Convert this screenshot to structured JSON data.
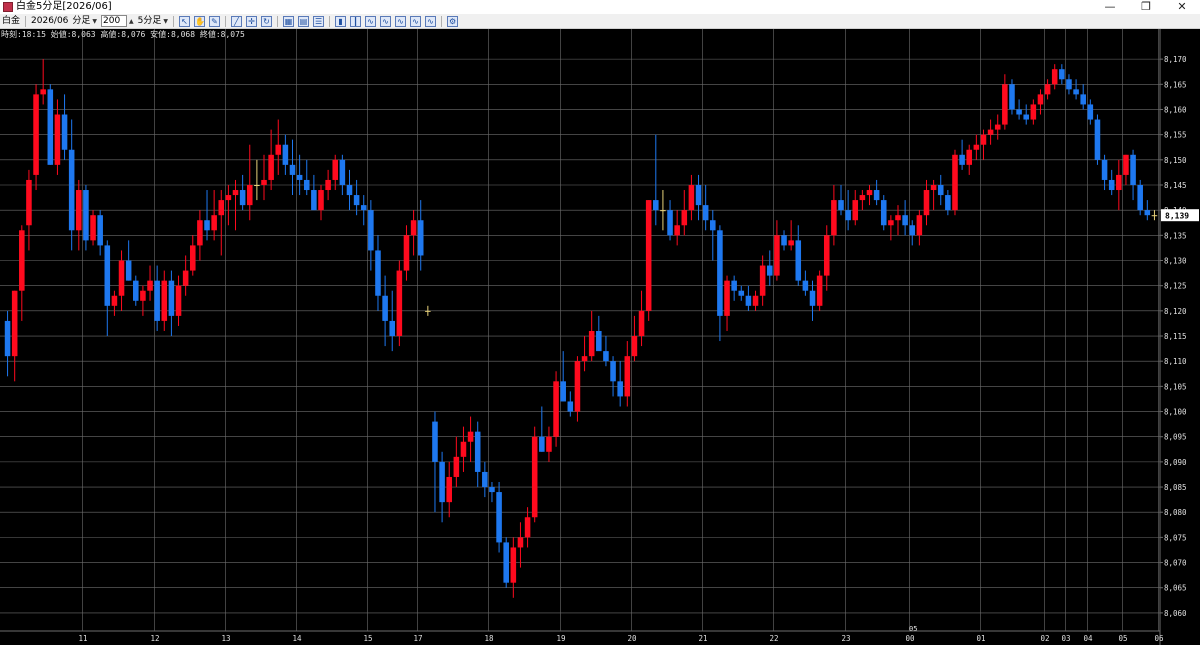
{
  "window": {
    "title": "白金5分足[2026/06]",
    "controls": [
      "—",
      "❐",
      "✕"
    ]
  },
  "toolbar": {
    "instrument": "白金",
    "contract": "2026/06",
    "unit": "分足",
    "bar_count": "200",
    "timeframe": "5分足",
    "icons": [
      "cursor-icon",
      "hand-icon",
      "pencil-icon",
      "trendline-icon",
      "crosshair-icon",
      "refresh-icon",
      "grid-icon",
      "table-icon",
      "list-icon",
      "bar-chart-icon",
      "candle-icon",
      "indicator-icon",
      "indicator2-icon",
      "indicator3-icon",
      "indicator4-icon",
      "indicator5-icon",
      "settings-icon"
    ]
  },
  "info": {
    "text": "時刻:18:15 始値:8,063 高値:8,076 安値:8,068 終値:8,075"
  },
  "colors": {
    "background": "#000000",
    "grid": "#6e6e6e",
    "up": "#ff0a1e",
    "down": "#1e78f0",
    "text": "#e0e0e0",
    "doji": "#e8d27a"
  },
  "chart_data": {
    "type": "candlestick",
    "ylim": [
      8057,
      8174
    ],
    "yticks": [
      {
        "value": 8060,
        "label": "8,060"
      },
      {
        "value": 8065,
        "label": "8,065"
      },
      {
        "value": 8070,
        "label": "8,070"
      },
      {
        "value": 8075,
        "label": "8,075"
      },
      {
        "value": 8080,
        "label": "8,080"
      },
      {
        "value": 8085,
        "label": "8,085"
      },
      {
        "value": 8090,
        "label": "8,090"
      },
      {
        "value": 8095,
        "label": "8,095"
      },
      {
        "value": 8100,
        "label": "8,100"
      },
      {
        "value": 8105,
        "label": "8,105"
      },
      {
        "value": 8110,
        "label": "8,110"
      },
      {
        "value": 8115,
        "label": "8,115"
      },
      {
        "value": 8120,
        "label": "8,120"
      },
      {
        "value": 8125,
        "label": "8,125"
      },
      {
        "value": 8130,
        "label": "8,130"
      },
      {
        "value": 8135,
        "label": "8,135"
      },
      {
        "value": 8140,
        "label": "8,140"
      },
      {
        "value": 8145,
        "label": "8,145"
      },
      {
        "value": 8150,
        "label": "8,150"
      },
      {
        "value": 8155,
        "label": "8,155"
      },
      {
        "value": 8160,
        "label": "8,160"
      },
      {
        "value": 8165,
        "label": "8,165"
      },
      {
        "value": 8170,
        "label": "8,170"
      }
    ],
    "last_price": {
      "value": 8139,
      "label": "8,139"
    },
    "x_labels": [
      {
        "label": "11",
        "index": 11
      },
      {
        "label": "12",
        "index": 21
      },
      {
        "label": "13",
        "index": 31
      },
      {
        "label": "14",
        "index": 41
      },
      {
        "label": "15",
        "index": 51
      },
      {
        "label": "17",
        "index": 58
      },
      {
        "label": "18",
        "index": 68
      },
      {
        "label": "19",
        "index": 78
      },
      {
        "label": "20",
        "index": 88
      },
      {
        "label": "21",
        "index": 98
      },
      {
        "label": "22",
        "index": 108
      },
      {
        "label": "23",
        "index": 118
      },
      {
        "label": "00",
        "index": 127
      },
      {
        "label": "01",
        "index": 137
      },
      {
        "label": "02",
        "index": 146
      },
      {
        "label": "03",
        "index": 149
      },
      {
        "label": "04",
        "index": 152
      },
      {
        "label": "05",
        "index": 157
      },
      {
        "label": "06",
        "index": 162
      }
    ],
    "upper_date_label": {
      "label": "05",
      "index": 127
    },
    "candles": [
      [
        8118,
        8120,
        8107,
        8111
      ],
      [
        8111,
        8124,
        8106,
        8124
      ],
      [
        8124,
        8137,
        8118,
        8136
      ],
      [
        8137,
        8148,
        8132,
        8146
      ],
      [
        8147,
        8165,
        8144,
        8163
      ],
      [
        8163,
        8170,
        8161,
        8164
      ],
      [
        8164,
        8165,
        8149,
        8149
      ],
      [
        8149,
        8162,
        8147,
        8159
      ],
      [
        8159,
        8163,
        8150,
        8152
      ],
      [
        8152,
        8158,
        8132,
        8136
      ],
      [
        8136,
        8146,
        8132,
        8144
      ],
      [
        8144,
        8145,
        8132,
        8134
      ],
      [
        8134,
        8140,
        8133,
        8139
      ],
      [
        8139,
        8140,
        8131,
        8133
      ],
      [
        8133,
        8134,
        8115,
        8121
      ],
      [
        8121,
        8124,
        8119,
        8123
      ],
      [
        8123,
        8132,
        8120,
        8130
      ],
      [
        8130,
        8134,
        8126,
        8126
      ],
      [
        8126,
        8127,
        8121,
        8122
      ],
      [
        8122,
        8125,
        8119,
        8124
      ],
      [
        8124,
        8129,
        8122,
        8126
      ],
      [
        8126,
        8129,
        8116,
        8118
      ],
      [
        8118,
        8128,
        8116,
        8126
      ],
      [
        8126,
        8128,
        8115,
        8119
      ],
      [
        8119,
        8127,
        8117,
        8125
      ],
      [
        8125,
        8131,
        8123,
        8128
      ],
      [
        8128,
        8135,
        8127,
        8133
      ],
      [
        8133,
        8140,
        8130,
        8138
      ],
      [
        8138,
        8144,
        8134,
        8136
      ],
      [
        8136,
        8144,
        8134,
        8139
      ],
      [
        8139,
        8144,
        8131,
        8142
      ],
      [
        8142,
        8145,
        8137,
        8143
      ],
      [
        8143,
        8146,
        8136,
        8144
      ],
      [
        8144,
        8147,
        8140,
        8141
      ],
      [
        8141,
        8153,
        8138,
        8145
      ],
      [
        8145,
        8150,
        8142,
        8145
      ],
      [
        8145,
        8151,
        8142,
        8146
      ],
      [
        8146,
        8156,
        8144,
        8151
      ],
      [
        8151,
        8158,
        8147,
        8153
      ],
      [
        8153,
        8155,
        8147,
        8149
      ],
      [
        8149,
        8154,
        8143,
        8147
      ],
      [
        8147,
        8151,
        8143,
        8146
      ],
      [
        8146,
        8150,
        8143,
        8144
      ],
      [
        8144,
        8147,
        8140,
        8140
      ],
      [
        8140,
        8145,
        8138,
        8144
      ],
      [
        8144,
        8148,
        8142,
        8146
      ],
      [
        8146,
        8151,
        8144,
        8150
      ],
      [
        8150,
        8151,
        8143,
        8145
      ],
      [
        8145,
        8148,
        8140,
        8143
      ],
      [
        8143,
        8146,
        8139,
        8141
      ],
      [
        8141,
        8143,
        8137,
        8140
      ],
      [
        8140,
        8142,
        8128,
        8132
      ],
      [
        8132,
        8135,
        8120,
        8123
      ],
      [
        8123,
        8127,
        8113,
        8118
      ],
      [
        8118,
        8124,
        8112,
        8115
      ],
      [
        8115,
        8130,
        8113,
        8128
      ],
      [
        8128,
        8137,
        8126,
        8135
      ],
      [
        8135,
        8140,
        8131,
        8138
      ],
      [
        8138,
        8142,
        8128,
        8131
      ],
      [
        8120,
        8121,
        8119,
        8120
      ],
      [
        8098,
        8100,
        8080,
        8090
      ],
      [
        8090,
        8092,
        8078,
        8082
      ],
      [
        8082,
        8090,
        8079,
        8087
      ],
      [
        8087,
        8095,
        8085,
        8091
      ],
      [
        8091,
        8097,
        8088,
        8094
      ],
      [
        8094,
        8099,
        8090,
        8096
      ],
      [
        8096,
        8098,
        8085,
        8088
      ],
      [
        8088,
        8090,
        8083,
        8085
      ],
      [
        8085,
        8086,
        8082,
        8084
      ],
      [
        8084,
        8086,
        8072,
        8074
      ],
      [
        8074,
        8075,
        8065,
        8066
      ],
      [
        8066,
        8075,
        8063,
        8073
      ],
      [
        8073,
        8078,
        8069,
        8075
      ],
      [
        8075,
        8081,
        8073,
        8079
      ],
      [
        8079,
        8097,
        8078,
        8095
      ],
      [
        8095,
        8101,
        8092,
        8092
      ],
      [
        8092,
        8097,
        8090,
        8095
      ],
      [
        8095,
        8108,
        8093,
        8106
      ],
      [
        8106,
        8112,
        8102,
        8102
      ],
      [
        8102,
        8104,
        8099,
        8100
      ],
      [
        8100,
        8111,
        8098,
        8110
      ],
      [
        8110,
        8115,
        8108,
        8111
      ],
      [
        8111,
        8120,
        8110,
        8116
      ],
      [
        8116,
        8119,
        8113,
        8112
      ],
      [
        8112,
        8115,
        8109,
        8110
      ],
      [
        8110,
        8111,
        8103,
        8106
      ],
      [
        8106,
        8110,
        8101,
        8103
      ],
      [
        8103,
        8114,
        8101,
        8111
      ],
      [
        8111,
        8119,
        8110,
        8115
      ],
      [
        8115,
        8124,
        8113,
        8120
      ],
      [
        8120,
        8142,
        8118,
        8142
      ],
      [
        8142,
        8155,
        8137,
        8140
      ],
      [
        8140,
        8144,
        8136,
        8140
      ],
      [
        8140,
        8142,
        8134,
        8135
      ],
      [
        8135,
        8140,
        8133,
        8137
      ],
      [
        8137,
        8144,
        8135,
        8140
      ],
      [
        8140,
        8147,
        8138,
        8145
      ],
      [
        8145,
        8147,
        8138,
        8141
      ],
      [
        8141,
        8145,
        8136,
        8138
      ],
      [
        8138,
        8140,
        8130,
        8136
      ],
      [
        8136,
        8137,
        8114,
        8119
      ],
      [
        8119,
        8127,
        8116,
        8126
      ],
      [
        8126,
        8127,
        8122,
        8124
      ],
      [
        8124,
        8125,
        8122,
        8123
      ],
      [
        8123,
        8125,
        8120,
        8121
      ],
      [
        8121,
        8124,
        8120,
        8123
      ],
      [
        8123,
        8131,
        8121,
        8129
      ],
      [
        8129,
        8132,
        8125,
        8127
      ],
      [
        8127,
        8138,
        8126,
        8135
      ],
      [
        8135,
        8136,
        8132,
        8133
      ],
      [
        8133,
        8138,
        8132,
        8134
      ],
      [
        8134,
        8137,
        8125,
        8126
      ],
      [
        8126,
        8128,
        8123,
        8124
      ],
      [
        8124,
        8126,
        8118,
        8121
      ],
      [
        8121,
        8128,
        8120,
        8127
      ],
      [
        8127,
        8137,
        8124,
        8135
      ],
      [
        8135,
        8145,
        8133,
        8142
      ],
      [
        8142,
        8145,
        8139,
        8140
      ],
      [
        8140,
        8144,
        8136,
        8138
      ],
      [
        8138,
        8144,
        8137,
        8142
      ],
      [
        8142,
        8144,
        8140,
        8143
      ],
      [
        8143,
        8145,
        8141,
        8144
      ],
      [
        8144,
        8146,
        8141,
        8142
      ],
      [
        8142,
        8143,
        8136,
        8137
      ],
      [
        8137,
        8139,
        8134,
        8138
      ],
      [
        8138,
        8141,
        8135,
        8139
      ],
      [
        8139,
        8142,
        8135,
        8137
      ],
      [
        8137,
        8138,
        8133,
        8135
      ],
      [
        8135,
        8140,
        8133,
        8139
      ],
      [
        8139,
        8146,
        8137,
        8144
      ],
      [
        8144,
        8146,
        8140,
        8145
      ],
      [
        8145,
        8147,
        8141,
        8143
      ],
      [
        8143,
        8144,
        8139,
        8140
      ],
      [
        8140,
        8152,
        8139,
        8151
      ],
      [
        8151,
        8154,
        8148,
        8149
      ],
      [
        8149,
        8153,
        8147,
        8152
      ],
      [
        8152,
        8155,
        8150,
        8153
      ],
      [
        8153,
        8156,
        8150,
        8155
      ],
      [
        8155,
        8158,
        8153,
        8156
      ],
      [
        8156,
        8159,
        8154,
        8157
      ],
      [
        8157,
        8167,
        8156,
        8165
      ],
      [
        8165,
        8166,
        8159,
        8160
      ],
      [
        8160,
        8162,
        8158,
        8159
      ],
      [
        8159,
        8161,
        8157,
        8158
      ],
      [
        8158,
        8162,
        8157,
        8161
      ],
      [
        8161,
        8164,
        8159,
        8163
      ],
      [
        8163,
        8166,
        8162,
        8165
      ],
      [
        8165,
        8169,
        8164,
        8168
      ],
      [
        8168,
        8169,
        8165,
        8166
      ],
      [
        8166,
        8167,
        8163,
        8164
      ],
      [
        8164,
        8166,
        8162,
        8163
      ],
      [
        8163,
        8165,
        8160,
        8161
      ],
      [
        8161,
        8162,
        8157,
        8158
      ],
      [
        8158,
        8159,
        8149,
        8150
      ],
      [
        8150,
        8151,
        8144,
        8146
      ],
      [
        8146,
        8148,
        8143,
        8144
      ],
      [
        8144,
        8150,
        8140,
        8147
      ],
      [
        8147,
        8151,
        8145,
        8151
      ],
      [
        8151,
        8152,
        8142,
        8145
      ],
      [
        8145,
        8146,
        8139,
        8140
      ],
      [
        8140,
        8142,
        8138,
        8139
      ],
      [
        8139,
        8140,
        8138,
        8139
      ]
    ]
  }
}
